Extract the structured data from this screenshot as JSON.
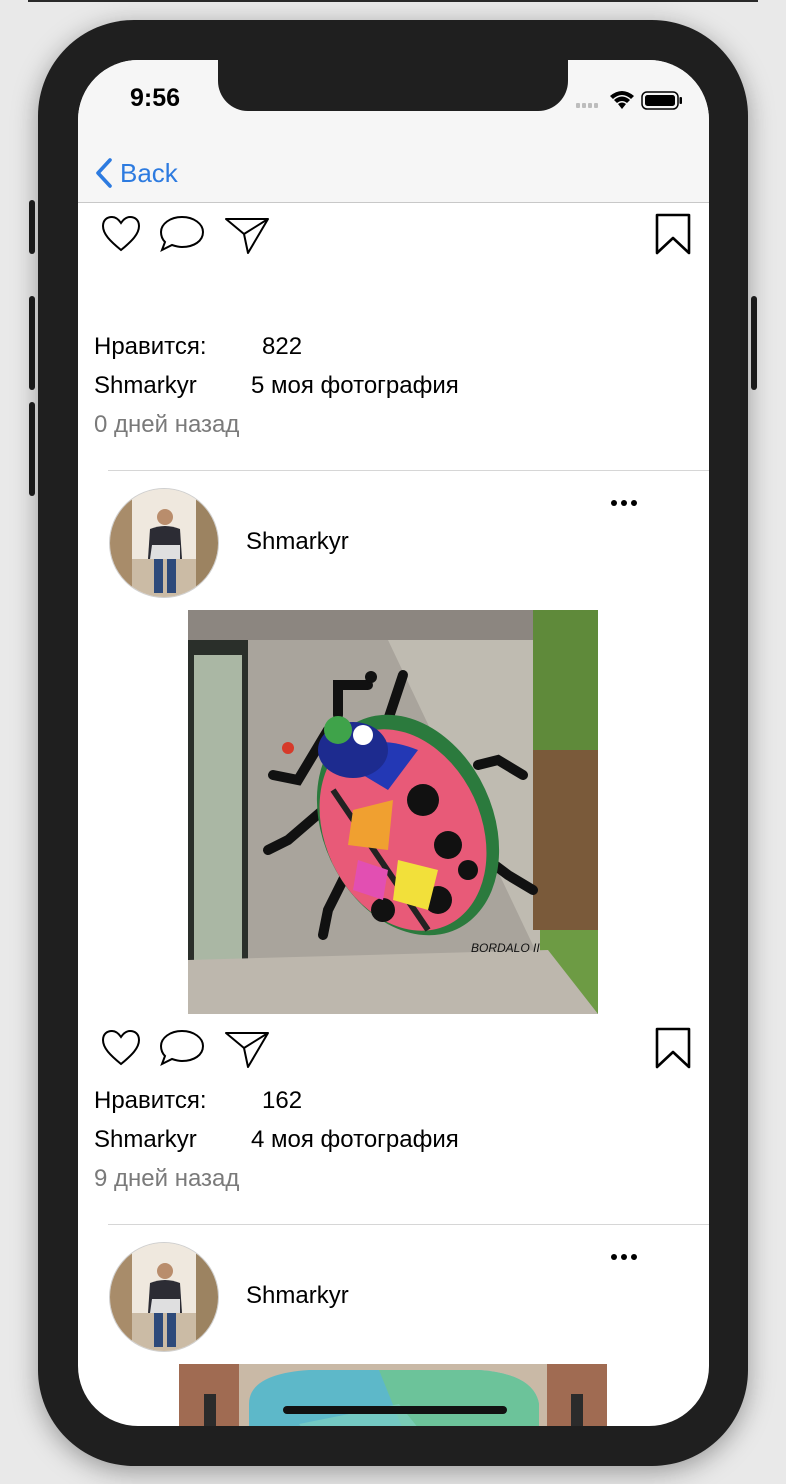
{
  "status_bar": {
    "time": "9:56"
  },
  "nav": {
    "back_label": "Back"
  },
  "posts": [
    {
      "likes_label": "Нравится:",
      "likes_count": "822",
      "author": "Shmarkyr",
      "caption": "5 моя фотография",
      "time_ago": "0 дней назад"
    },
    {
      "author": "Shmarkyr",
      "likes_label": "Нравится:",
      "likes_count": "162",
      "caption": "4 моя фотография",
      "time_ago": "9 дней назад",
      "photo_signature": "BORDALO II"
    },
    {
      "author": "Shmarkyr"
    }
  ],
  "colors": {
    "accent": "#2d7be0",
    "muted_text": "#7a7a7a",
    "divider": "#d6d6d6"
  }
}
